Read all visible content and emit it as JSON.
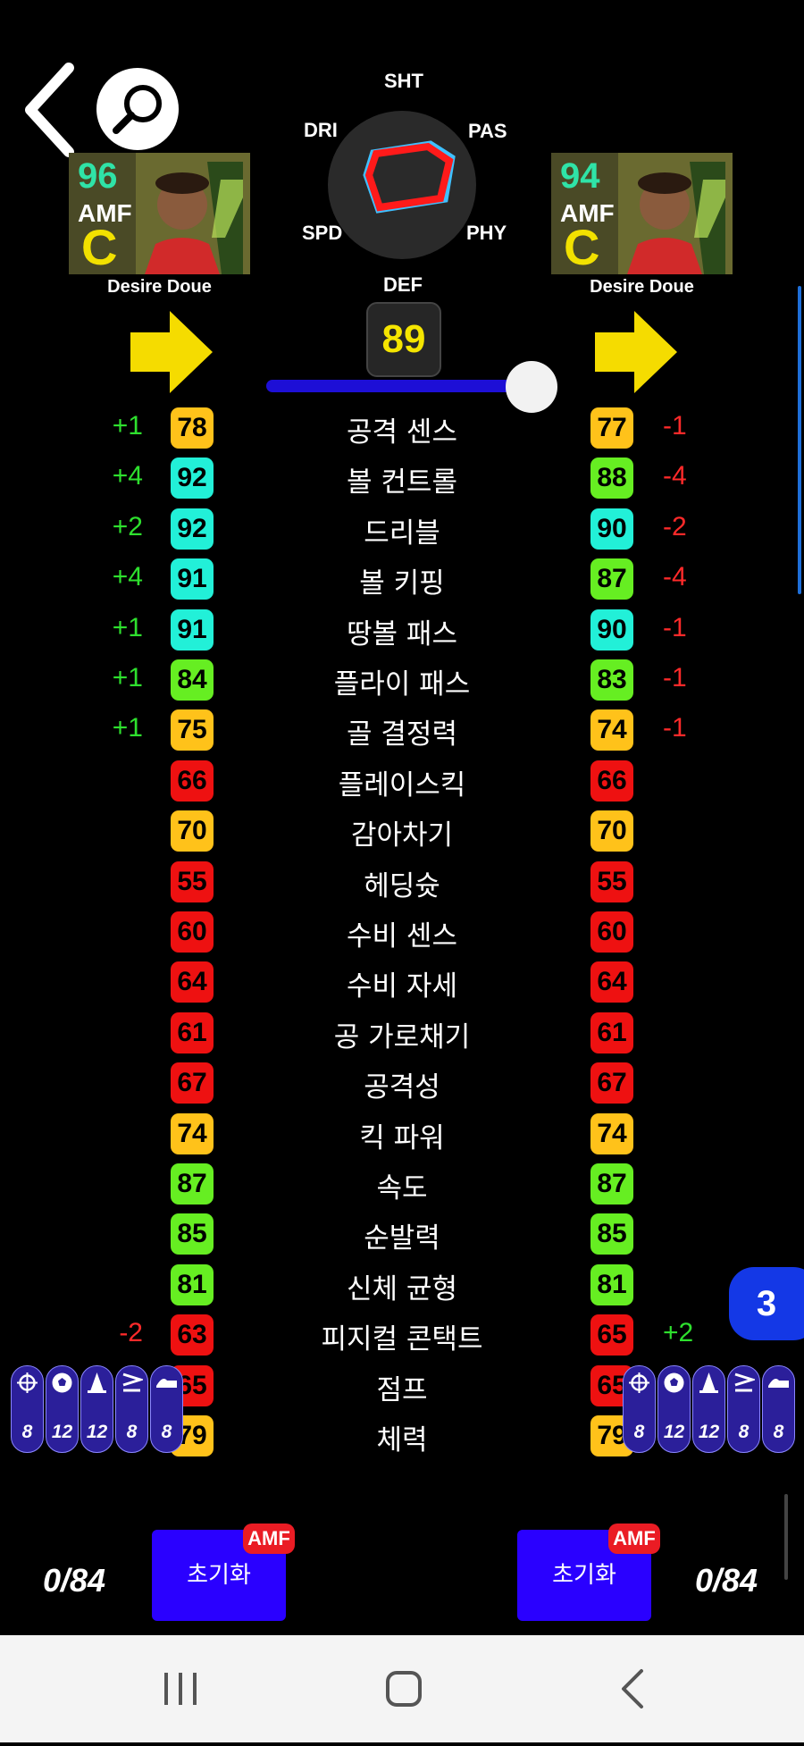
{
  "header": {
    "back_icon": "chevron-left-icon",
    "search_icon": "search-icon"
  },
  "radar": {
    "labels": {
      "sht": "SHT",
      "pas": "PAS",
      "phy": "PHY",
      "def": "DEF",
      "spd": "SPD",
      "dri": "DRI"
    },
    "left_color": "#ff1a1a",
    "right_color": "#3fc0ff"
  },
  "left_player": {
    "rating": "96",
    "position": "AMF",
    "grade": "C",
    "name": "Desire Doue",
    "rating_color": "#2fe3a7"
  },
  "right_player": {
    "rating": "94",
    "position": "AMF",
    "grade": "C",
    "name": "Desire Doue",
    "rating_color": "#2fe3a7"
  },
  "center_badge": {
    "value": "89"
  },
  "slider": {
    "level": 1.0
  },
  "stats": [
    {
      "label": "공격 센스",
      "left": "78",
      "right": "77",
      "ld": "+1",
      "rd": "-1",
      "lc": "#ffc21a",
      "rc": "#ffc21a"
    },
    {
      "label": "볼 컨트롤",
      "left": "92",
      "right": "88",
      "ld": "+4",
      "rd": "-4",
      "lc": "#22f0d8",
      "rc": "#66ee22"
    },
    {
      "label": "드리블",
      "left": "92",
      "right": "90",
      "ld": "+2",
      "rd": "-2",
      "lc": "#22f0d8",
      "rc": "#22f0d8"
    },
    {
      "label": "볼 키핑",
      "left": "91",
      "right": "87",
      "ld": "+4",
      "rd": "-4",
      "lc": "#22f0d8",
      "rc": "#66ee22"
    },
    {
      "label": "땅볼 패스",
      "left": "91",
      "right": "90",
      "ld": "+1",
      "rd": "-1",
      "lc": "#22f0d8",
      "rc": "#22f0d8"
    },
    {
      "label": "플라이 패스",
      "left": "84",
      "right": "83",
      "ld": "+1",
      "rd": "-1",
      "lc": "#66ee22",
      "rc": "#66ee22"
    },
    {
      "label": "골 결정력",
      "left": "75",
      "right": "74",
      "ld": "+1",
      "rd": "-1",
      "lc": "#ffc21a",
      "rc": "#ffc21a"
    },
    {
      "label": "플레이스킥",
      "left": "66",
      "right": "66",
      "ld": "",
      "rd": "",
      "lc": "#ee1111",
      "rc": "#ee1111"
    },
    {
      "label": "감아차기",
      "left": "70",
      "right": "70",
      "ld": "",
      "rd": "",
      "lc": "#ffc21a",
      "rc": "#ffc21a"
    },
    {
      "label": "헤딩슛",
      "left": "55",
      "right": "55",
      "ld": "",
      "rd": "",
      "lc": "#ee1111",
      "rc": "#ee1111"
    },
    {
      "label": "수비 센스",
      "left": "60",
      "right": "60",
      "ld": "",
      "rd": "",
      "lc": "#ee1111",
      "rc": "#ee1111"
    },
    {
      "label": "수비 자세",
      "left": "64",
      "right": "64",
      "ld": "",
      "rd": "",
      "lc": "#ee1111",
      "rc": "#ee1111"
    },
    {
      "label": "공 가로채기",
      "left": "61",
      "right": "61",
      "ld": "",
      "rd": "",
      "lc": "#ee1111",
      "rc": "#ee1111"
    },
    {
      "label": "공격성",
      "left": "67",
      "right": "67",
      "ld": "",
      "rd": "",
      "lc": "#ee1111",
      "rc": "#ee1111"
    },
    {
      "label": "킥 파워",
      "left": "74",
      "right": "74",
      "ld": "",
      "rd": "",
      "lc": "#ffc21a",
      "rc": "#ffc21a"
    },
    {
      "label": "속도",
      "left": "87",
      "right": "87",
      "ld": "",
      "rd": "",
      "lc": "#66ee22",
      "rc": "#66ee22"
    },
    {
      "label": "순발력",
      "left": "85",
      "right": "85",
      "ld": "",
      "rd": "",
      "lc": "#66ee22",
      "rc": "#66ee22"
    },
    {
      "label": "신체 균형",
      "left": "81",
      "right": "81",
      "ld": "",
      "rd": "",
      "lc": "#66ee22",
      "rc": "#66ee22"
    },
    {
      "label": "피지컬 콘택트",
      "left": "63",
      "right": "65",
      "ld": "-2",
      "rd": "+2",
      "lc": "#ee1111",
      "rc": "#ee1111"
    },
    {
      "label": "점프",
      "left": "65",
      "right": "65",
      "ld": "",
      "rd": "",
      "lc": "#ee1111",
      "rc": "#ee1111"
    },
    {
      "label": "체력",
      "left": "79",
      "right": "79",
      "ld": "",
      "rd": "",
      "lc": "#ffc21a",
      "rc": "#ffc21a"
    }
  ],
  "skills_left": [
    {
      "icon": "target-icon",
      "value": "8"
    },
    {
      "icon": "ball-icon",
      "value": "12"
    },
    {
      "icon": "cone-icon",
      "value": "12"
    },
    {
      "icon": "speed-lines-icon",
      "value": "8"
    },
    {
      "icon": "boot-icon",
      "value": "8"
    }
  ],
  "skills_right": [
    {
      "icon": "target-icon",
      "value": "8"
    },
    {
      "icon": "ball-icon",
      "value": "12"
    },
    {
      "icon": "cone-icon",
      "value": "12"
    },
    {
      "icon": "speed-lines-icon",
      "value": "8"
    },
    {
      "icon": "boot-icon",
      "value": "8"
    }
  ],
  "page_badge": "3",
  "footer": {
    "left_points": "0/84",
    "right_points": "0/84",
    "reset_label": "초기화",
    "amf_tag": "AMF"
  },
  "navbar": {
    "recent_icon": "recent-apps-icon",
    "home_icon": "home-icon",
    "back_icon": "back-icon"
  },
  "colors": {
    "delta_positive": "#2ee02e",
    "delta_negative": "#ff2a2a",
    "accent_blue": "#2a00ff"
  }
}
